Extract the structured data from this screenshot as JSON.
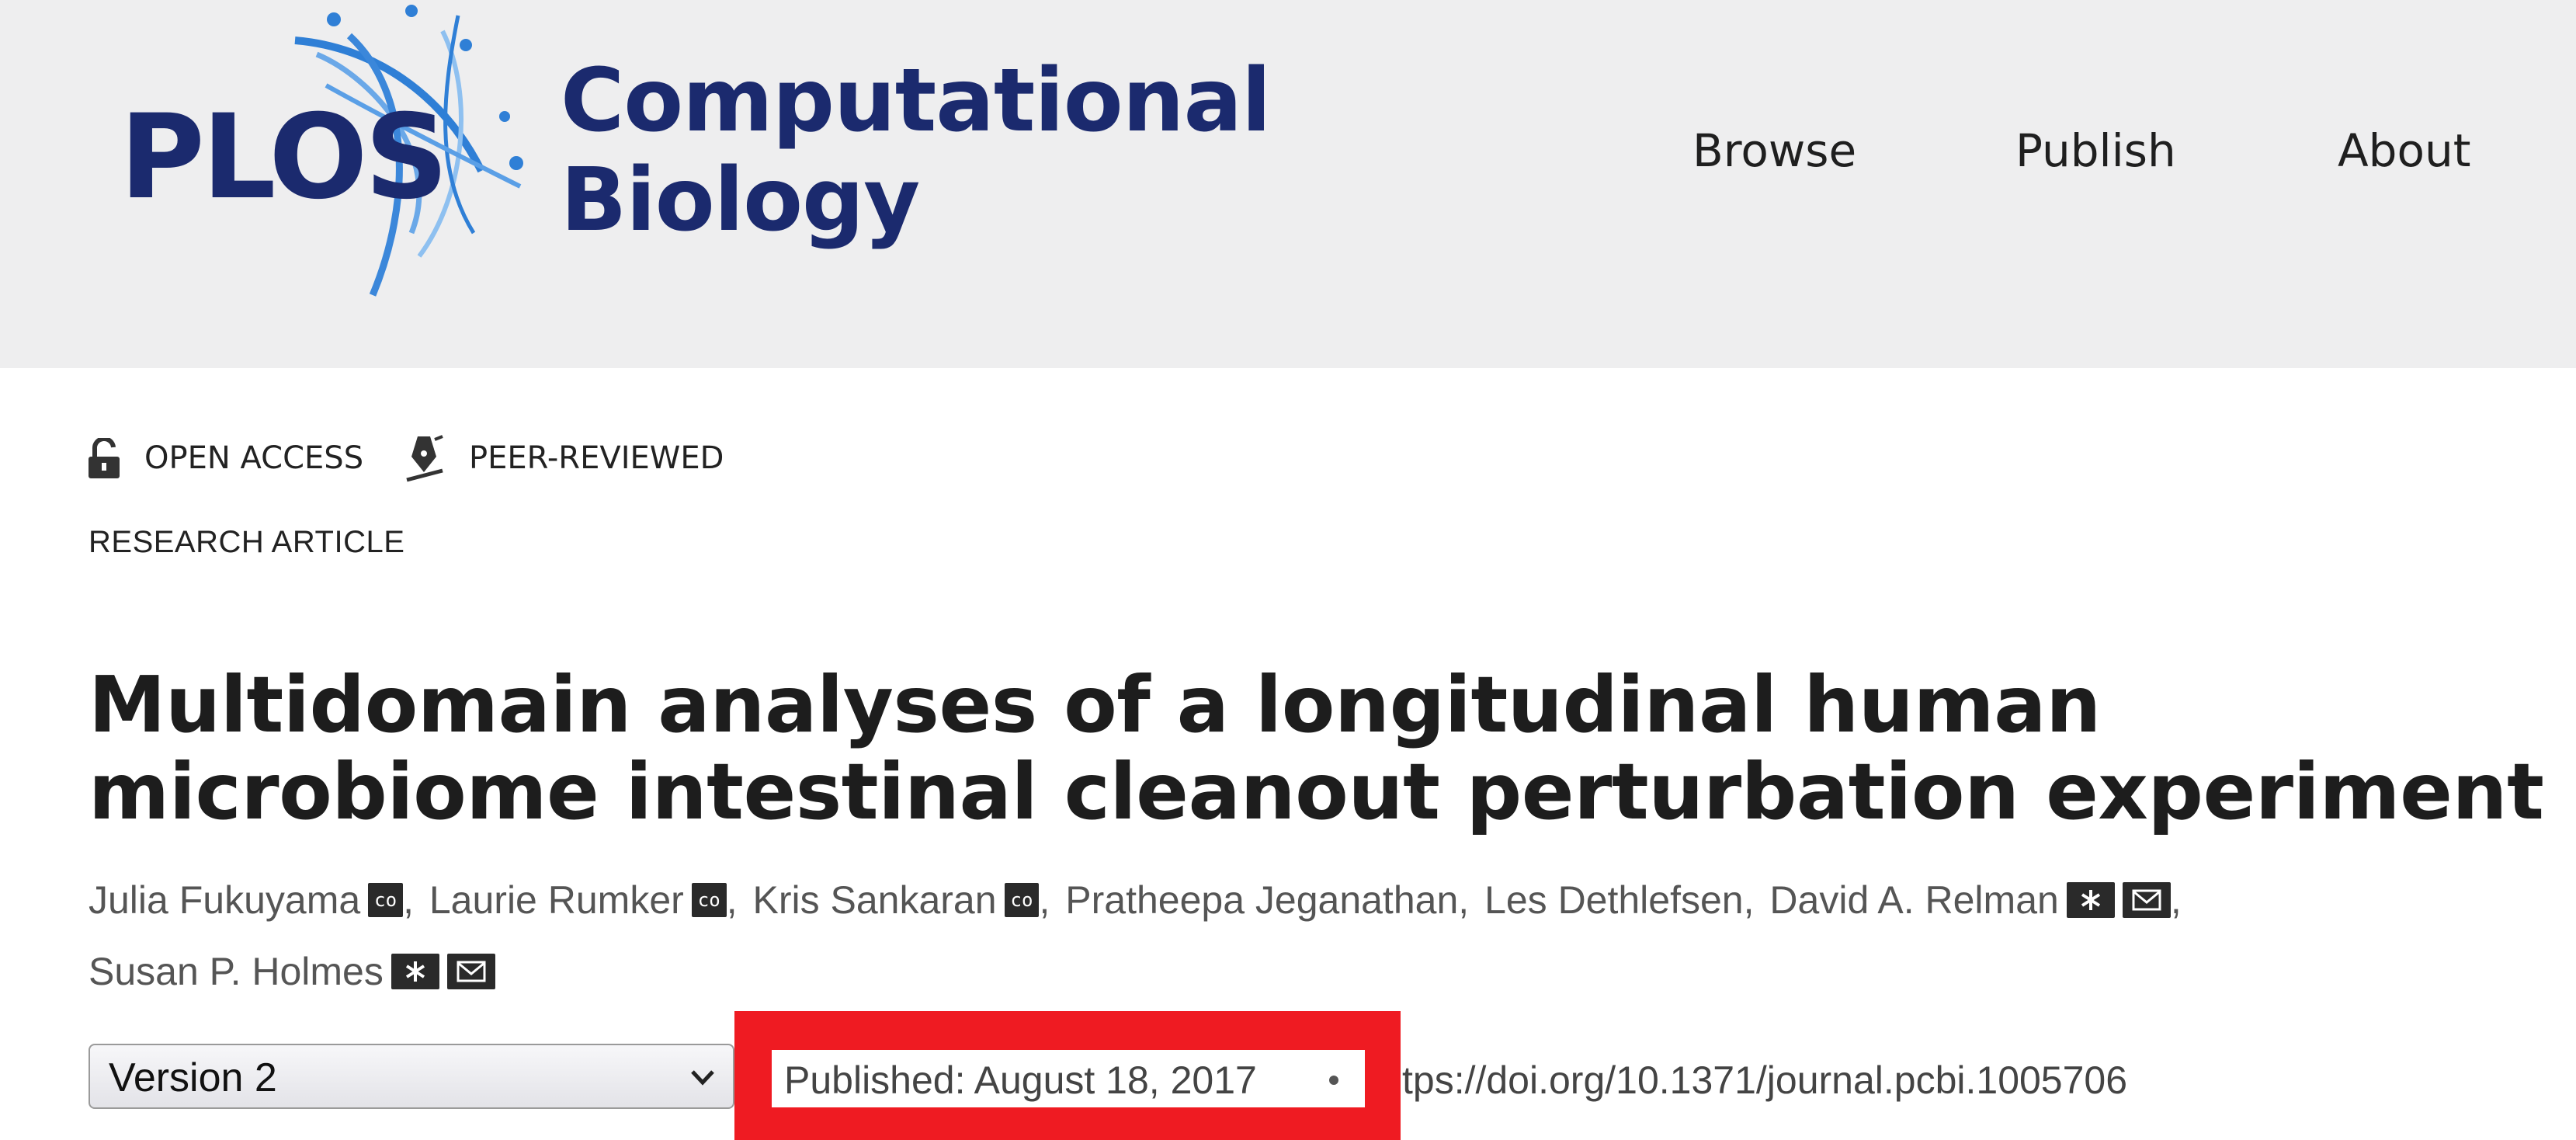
{
  "header": {
    "logo": {
      "plos": "PLOS",
      "title_line1": "Computational",
      "title_line2": "Biology"
    },
    "nav": [
      "Browse",
      "Publish",
      "About"
    ]
  },
  "badges": {
    "open_access": "OPEN ACCESS",
    "peer_reviewed": "PEER-REVIEWED"
  },
  "article": {
    "type": "RESEARCH ARTICLE",
    "title": "Multidomain analyses of a longitudinal human microbiome intestinal cleanout perturbation experiment",
    "authors": [
      {
        "name": "Julia Fukuyama",
        "marks": [
          "co"
        ]
      },
      {
        "name": "Laurie Rumker",
        "marks": [
          "co"
        ]
      },
      {
        "name": "Kris Sankaran",
        "marks": [
          "co"
        ]
      },
      {
        "name": "Pratheepa Jeganathan",
        "marks": []
      },
      {
        "name": "Les Dethlefsen",
        "marks": []
      },
      {
        "name": "David A. Relman",
        "marks": [
          "asterisk-icon",
          "envelope-icon"
        ]
      },
      {
        "name": "Susan P. Holmes",
        "marks": [
          "asterisk-icon",
          "envelope-icon"
        ]
      }
    ],
    "version": {
      "selected": "Version 2"
    },
    "published": "Published: August 18, 2017",
    "doi": "tps://doi.org/10.1371/journal.pcbi.1005706"
  },
  "colors": {
    "header_bg": "#eeeeef",
    "brand_navy": "#1b2a6e",
    "brand_blue": "#2f7fd6",
    "highlight_red": "#ef1b22"
  }
}
